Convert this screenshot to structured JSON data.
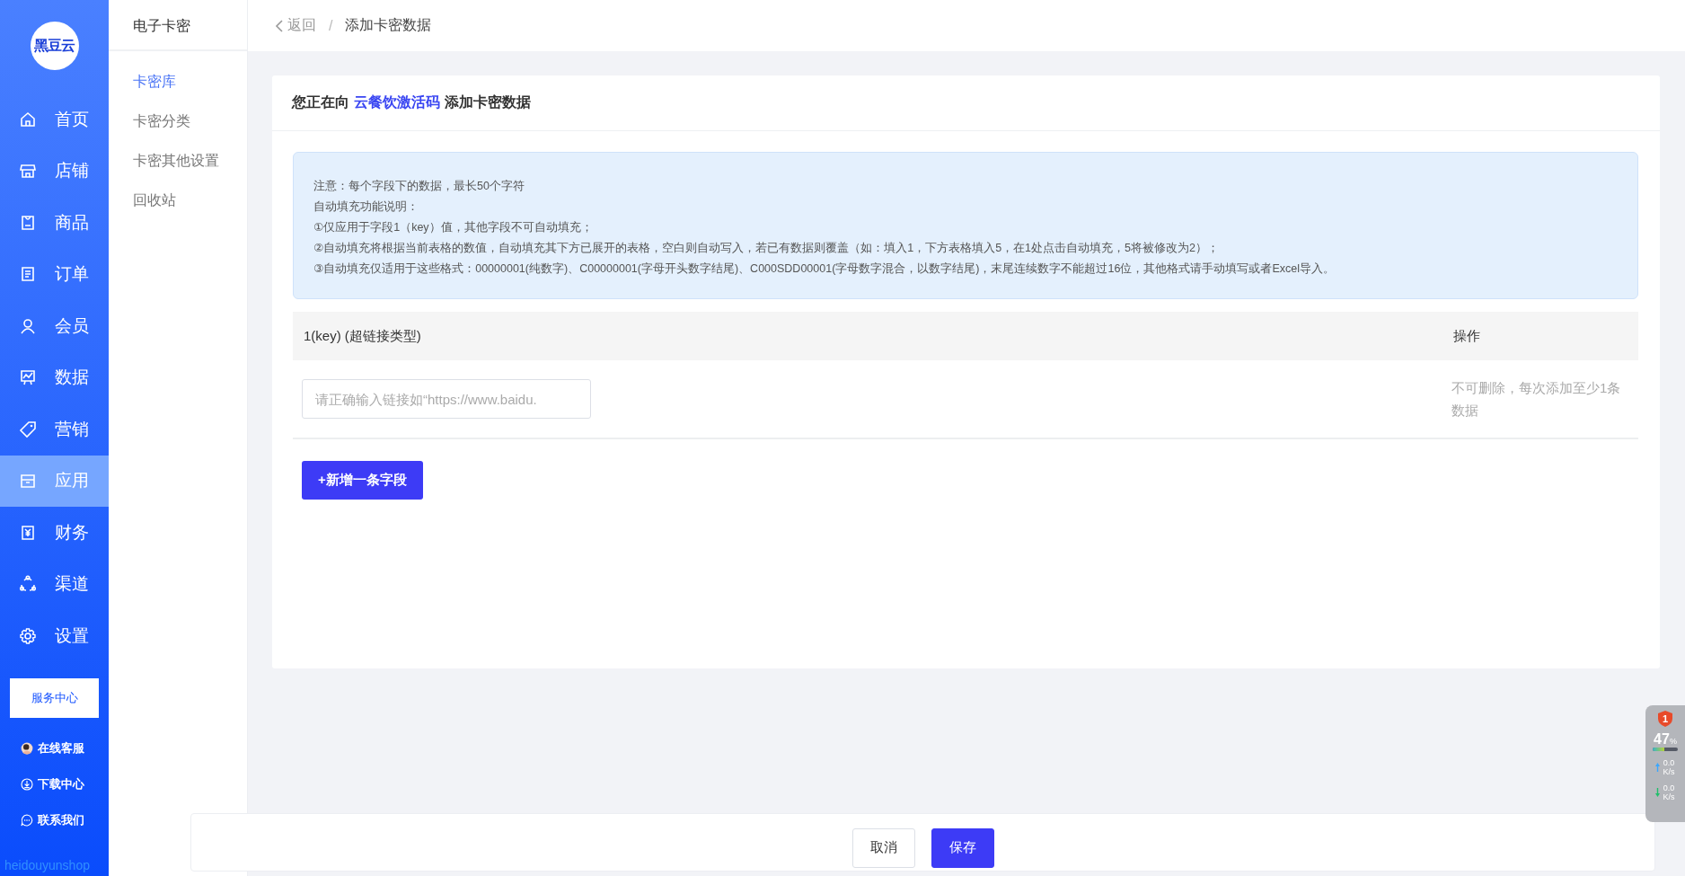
{
  "logo": {
    "text": "黑豆云"
  },
  "nav": [
    {
      "label": "首页",
      "kind": "home",
      "selected": false
    },
    {
      "label": "店铺",
      "kind": "store",
      "selected": false
    },
    {
      "label": "商品",
      "kind": "goods",
      "selected": false
    },
    {
      "label": "订单",
      "kind": "order",
      "selected": false
    },
    {
      "label": "会员",
      "kind": "user",
      "selected": false
    },
    {
      "label": "数据",
      "kind": "chart",
      "selected": false
    },
    {
      "label": "营销",
      "kind": "tag",
      "selected": false
    },
    {
      "label": "应用",
      "kind": "box",
      "selected": true
    },
    {
      "label": "财务",
      "kind": "money",
      "selected": false
    },
    {
      "label": "渠道",
      "kind": "share",
      "selected": false
    },
    {
      "label": "设置",
      "kind": "gear",
      "selected": false
    }
  ],
  "service_center": "服务中心",
  "links": [
    {
      "label": "在线客服",
      "kind": "avatar"
    },
    {
      "label": "下载中心",
      "kind": "download"
    },
    {
      "label": "联系我们",
      "kind": "chat"
    }
  ],
  "brand_footer": "heidouyunshop",
  "submenu": {
    "title": "电子卡密",
    "items": [
      {
        "label": "卡密库",
        "selected": true
      },
      {
        "label": "卡密分类",
        "selected": false
      },
      {
        "label": "卡密其他设置",
        "selected": false
      },
      {
        "label": "回收站",
        "selected": false
      }
    ]
  },
  "breadcrumb": {
    "back": "返回",
    "separator": "/",
    "current": "添加卡密数据"
  },
  "card": {
    "title_prefix": "您正在向",
    "target": "云餐饮激活码",
    "title_suffix": "添加卡密数据"
  },
  "notice": [
    "注意：每个字段下的数据，最长50个字符",
    "自动填充功能说明：",
    "①仅应用于字段1（key）值，其他字段不可自动填充；",
    "②自动填充将根据当前表格的数值，自动填充其下方已展开的表格，空白则自动写入，若已有数据则覆盖（如：填入1，下方表格填入5，在1处点击自动填充，5将被修改为2）；",
    "③自动填充仅适用于这些格式：00000001(纯数字)、C00000001(字母开头数字结尾)、C000SDD00001(字母数字混合，以数字结尾)，末尾连续数字不能超过16位，其他格式请手动填写或者Excel导入。"
  ],
  "table": {
    "columns": [
      "1(key) (超链接类型)",
      "操作"
    ],
    "rows": [
      {
        "placeholder": "请正确输入链接如“https://www.baidu.",
        "note": "不可删除，每次添加至少1条数据"
      }
    ]
  },
  "add_button": "+新增一条字段",
  "footer": {
    "buttons": [
      {
        "label": "取消",
        "kind": "default"
      },
      {
        "label": "保存",
        "kind": "primary"
      }
    ]
  },
  "monitor": {
    "badge": "1",
    "percent": "47",
    "unit": "%",
    "level": 0.47,
    "rates": [
      {
        "kind": "up",
        "value": "0.0",
        "unit": "K/s"
      },
      {
        "kind": "down",
        "value": "0.0",
        "unit": "K/s"
      }
    ]
  }
}
